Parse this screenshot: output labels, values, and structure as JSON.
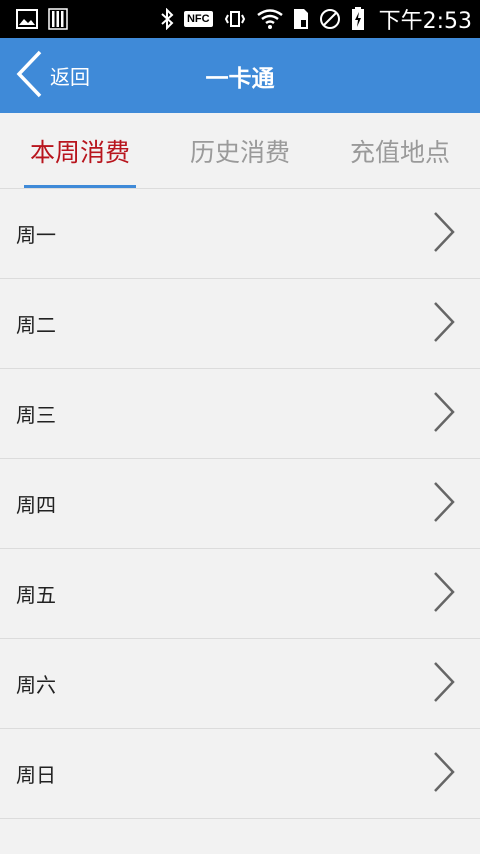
{
  "status_bar": {
    "time": "下午2:53",
    "nfc": "NFC",
    "icons": [
      "image-icon",
      "sim-bars-icon",
      "bluetooth-icon",
      "nfc-icon",
      "vibrate-icon",
      "wifi-icon",
      "sim-card-icon",
      "do-not-disturb-icon",
      "battery-charging-icon"
    ]
  },
  "app_bar": {
    "back_label": "返回",
    "title": "一卡通",
    "color": "#3f8ad8"
  },
  "tabs": [
    {
      "label": "本周消费",
      "active": true
    },
    {
      "label": "历史消费",
      "active": false
    },
    {
      "label": "充值地点",
      "active": false
    }
  ],
  "days": [
    {
      "label": "周一"
    },
    {
      "label": "周二"
    },
    {
      "label": "周三"
    },
    {
      "label": "周四"
    },
    {
      "label": "周五"
    },
    {
      "label": "周六"
    },
    {
      "label": "周日"
    }
  ],
  "colors": {
    "active_tab": "#b8151d",
    "inactive_tab": "#9a9a9a",
    "background": "#f2f2f2"
  }
}
